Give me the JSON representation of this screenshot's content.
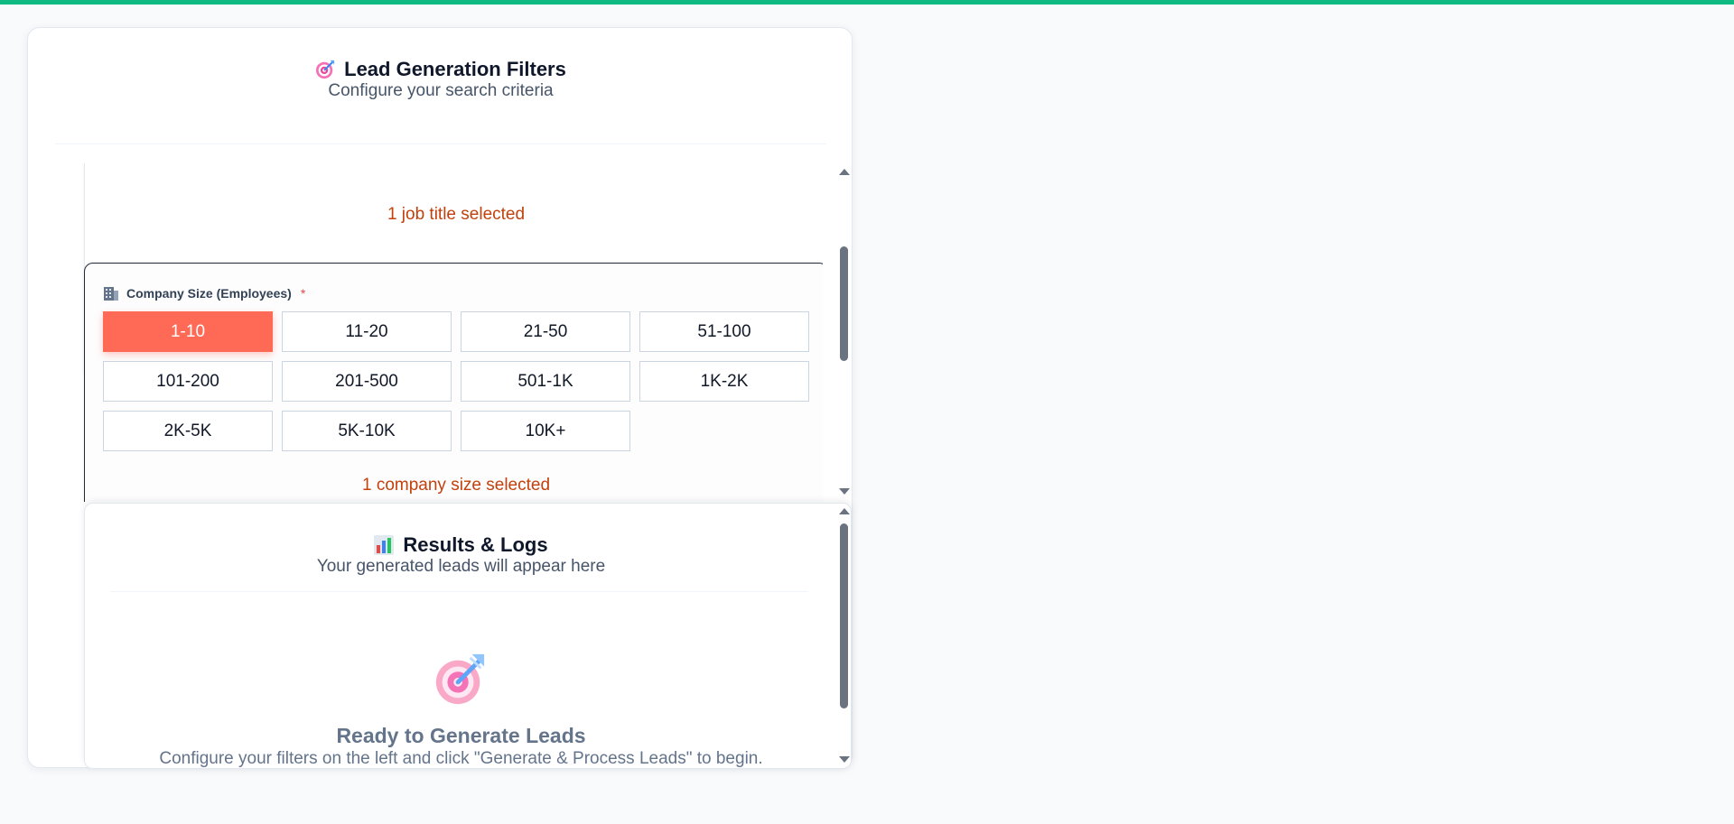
{
  "filters": {
    "title": "Lead Generation Filters",
    "subtitle": "Configure your search criteria",
    "title_icon": "target-icon",
    "job_titles": {
      "selected_text": "1 job title selected"
    },
    "company_size": {
      "label": "Company Size (Employees)",
      "required_mark": "*",
      "icon": "building-icon",
      "options": [
        "1-10",
        "11-20",
        "21-50",
        "51-100",
        "101-200",
        "201-500",
        "501-1K",
        "1K-2K",
        "2K-5K",
        "5K-10K",
        "10K+"
      ],
      "selected": "1-10",
      "selected_text": "1 company size selected"
    }
  },
  "results": {
    "title": "Results & Logs",
    "subtitle": "Your generated leads will appear here",
    "title_icon": "bar-chart-icon",
    "empty_icon": "target-icon",
    "empty_title": "Ready to Generate Leads",
    "empty_text": "Configure your filters on the left and click \"Generate & Process Leads\" to begin."
  },
  "colors": {
    "accent": "#ff6a56",
    "top_bar": "#10b981",
    "selected_note": "#c2410c"
  }
}
